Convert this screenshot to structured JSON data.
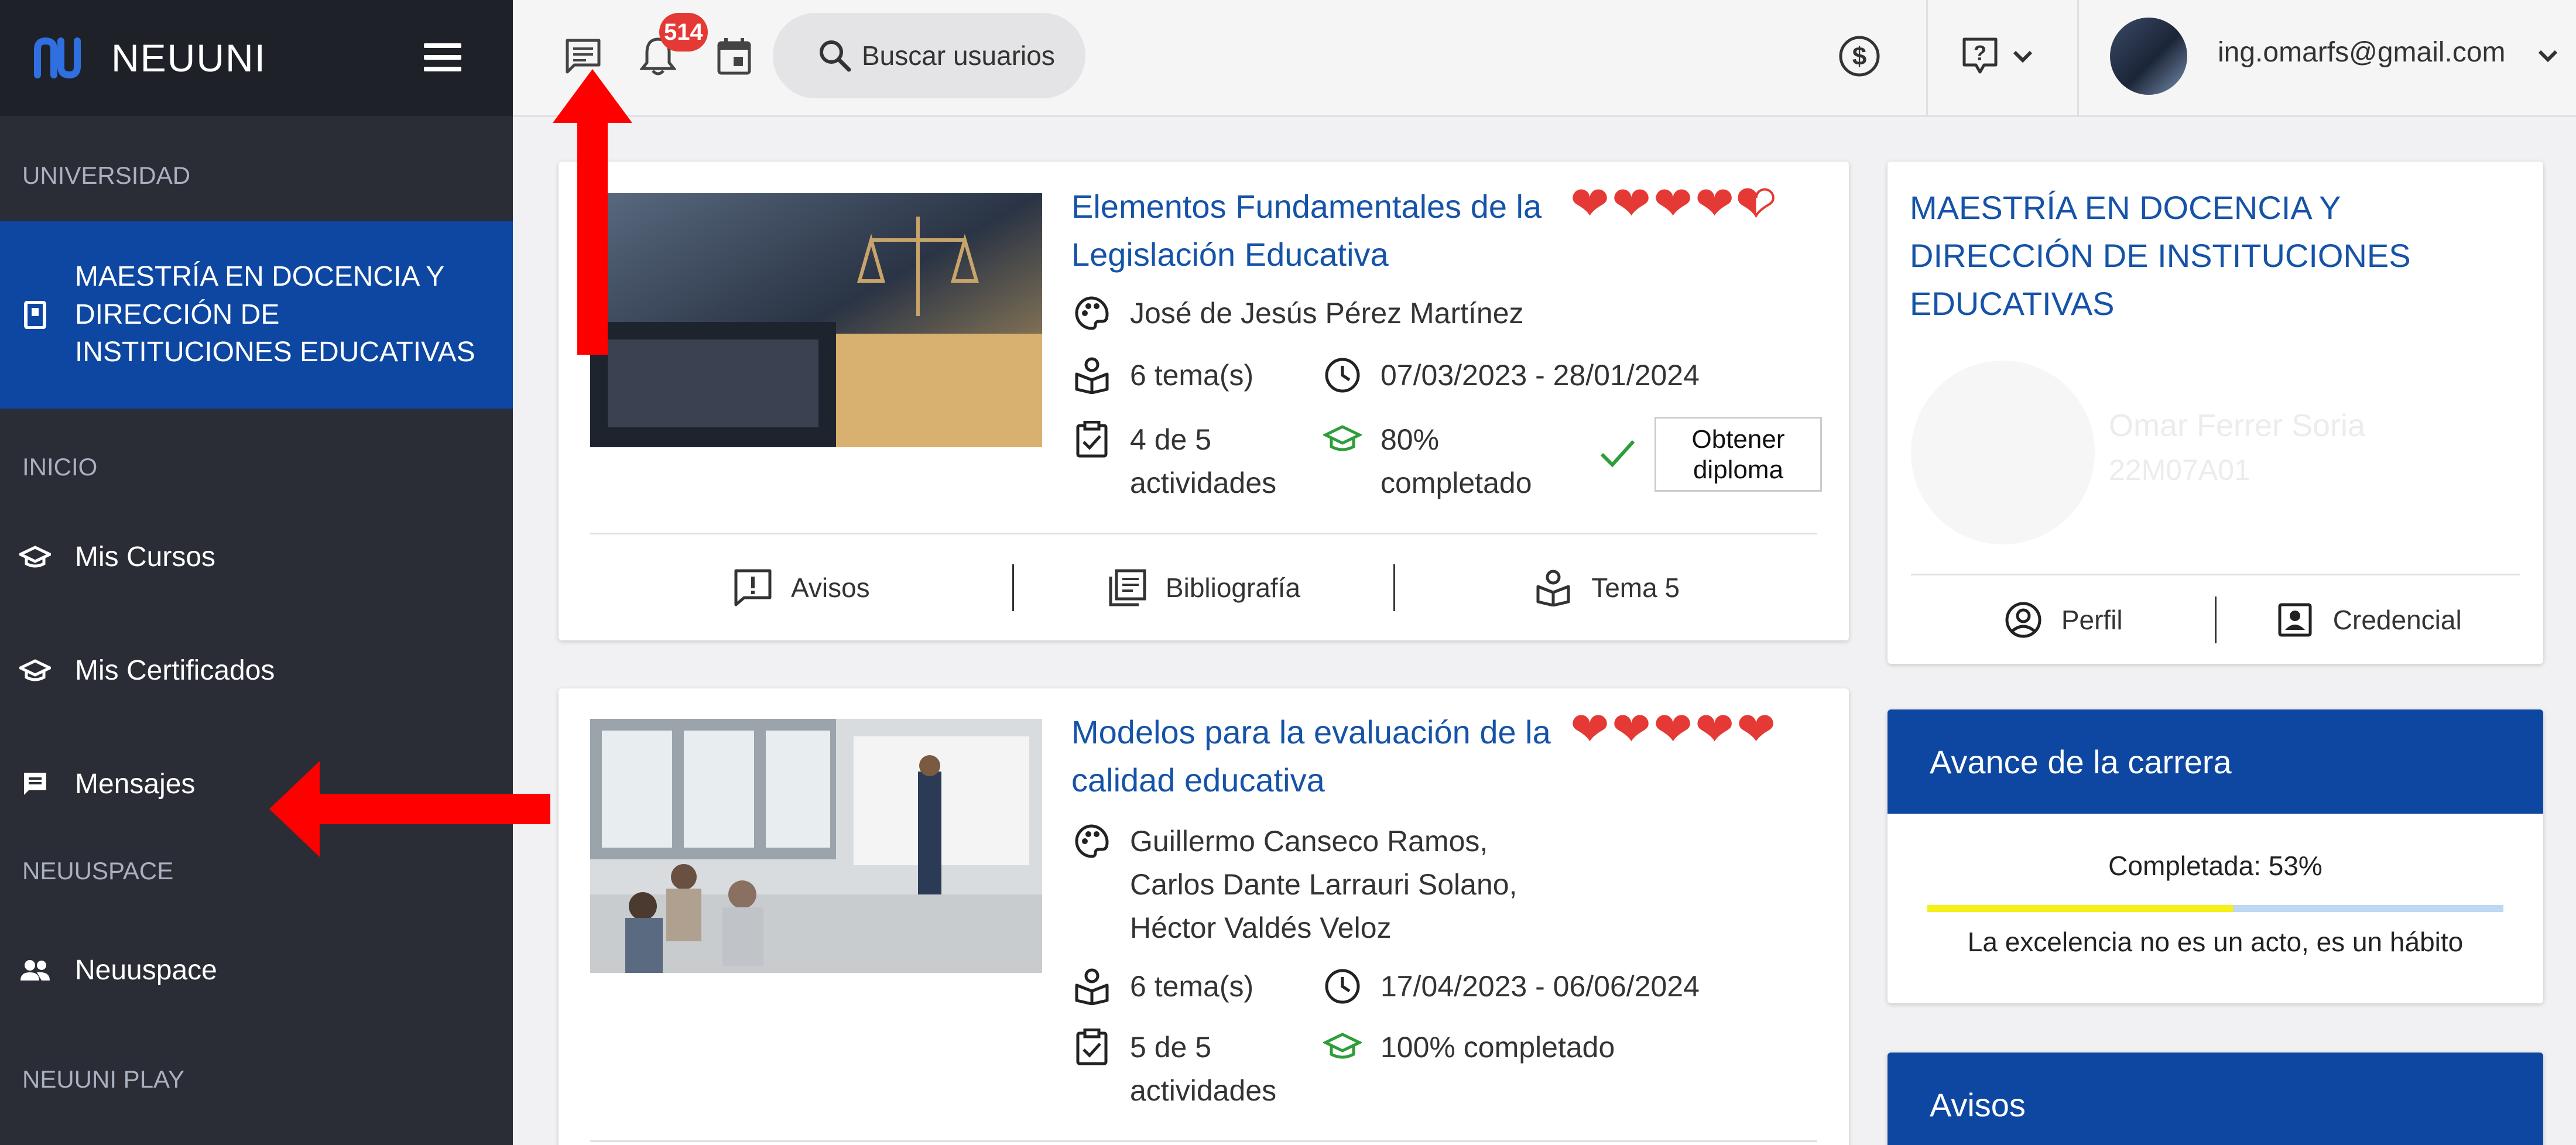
{
  "sidebar": {
    "brand": "NEUUNI",
    "sections": {
      "universidad": "UNIVERSIDAD",
      "inicio": "INICIO",
      "neuuspace": "NEUUSPACE",
      "neuuniplay": "NEUUNI PLAY"
    },
    "program": "MAESTRÍA EN DOCENCIA Y DIRECCIÓN DE INSTITUCIONES EDUCATIVAS",
    "items": {
      "mis_cursos": "Mis Cursos",
      "mis_certificados": "Mis Certificados",
      "mensajes": "Mensajes",
      "neuuspace": "Neuuspace"
    }
  },
  "topbar": {
    "notification_count": "514",
    "search_label": "Buscar usuarios",
    "user_email": "ing.omarfs@gmail.com"
  },
  "courses": [
    {
      "title": "Elementos Fundamentales de la Legislación Educativa",
      "hearts": 4.5,
      "teacher": "José de Jesús Pérez Martínez",
      "topics": "6 tema(s)",
      "dates": "07/03/2023 - 28/01/2024",
      "activities": "4 de 5 actividades",
      "progress": "80% completado",
      "diploma_button": "Obtener diploma",
      "footer": {
        "avisos": "Avisos",
        "bibliografia": "Bibliografía",
        "tema": "Tema 5"
      }
    },
    {
      "title": "Modelos para la evaluación de la calidad educativa",
      "hearts": 5,
      "teacher": "Guillermo Canseco Ramos,\nCarlos Dante Larrauri Solano,\nHéctor Valdés Veloz",
      "topics": "6 tema(s)",
      "dates": "17/04/2023 - 06/06/2024",
      "activities": "5 de 5 actividades",
      "progress": "100% completado"
    }
  ],
  "profile_card": {
    "program": "MAESTRÍA EN DOCENCIA Y DIRECCIÓN DE INSTITUCIONES EDUCATIVAS",
    "name": "Omar Ferrer Soria",
    "student_id": "22M07A01",
    "perfil": "Perfil",
    "credencial": "Credencial"
  },
  "career_progress": {
    "title": "Avance de la carrera",
    "completed_label": "Completada: 53%",
    "completed_fraction": 0.53,
    "quote": "La excelencia no es un acto, es un hábito"
  },
  "avisos_panel": {
    "title": "Avisos"
  },
  "colors": {
    "sidebar_bg": "#2a2d35",
    "accent_blue": "#0d47a1",
    "link_blue": "#1553a8",
    "heart_red": "#e53935",
    "success_green": "#2e9d3a",
    "progress_yellow": "#f5ef1a",
    "progress_track": "#bcd8f2",
    "annotation_red": "#ff0000"
  }
}
